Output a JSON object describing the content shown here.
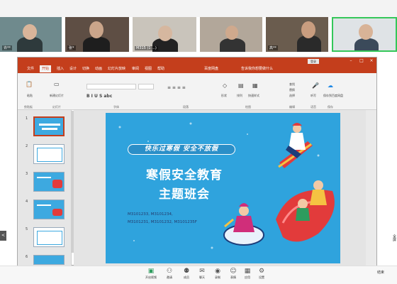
{
  "meeting": {
    "title": "",
    "top_right": "",
    "participants": [
      {
        "name": "许**",
        "bg": "#6f8a8d"
      },
      {
        "name": "张*",
        "bg": "#5e4e44"
      },
      {
        "name": "M315 (1 ...)",
        "bg": "#c9c4bb"
      },
      {
        "name": "",
        "bg": "#b2a79a"
      },
      {
        "name": "高**",
        "bg": "#6a5c4e"
      },
      {
        "name": "",
        "bg": "#dfe3e6"
      }
    ],
    "active_speaker_icon": "microphone-icon"
  },
  "ppt": {
    "app_title": "",
    "login_label": "登录",
    "window_controls": [
      "minimize-icon",
      "maximize-icon",
      "close-icon"
    ],
    "menu": [
      "文件",
      "开始",
      "插入",
      "设计",
      "切换",
      "动画",
      "幻灯片放映",
      "审阅",
      "视图",
      "帮助",
      "百度网盘",
      "告诉我你想要做什么"
    ],
    "active_menu": "开始",
    "ribbon_groups": [
      "剪贴板",
      "幻灯片",
      "字体",
      "段落",
      "绘图",
      "编辑",
      "语音",
      "保存"
    ],
    "ribbon_labels": {
      "paste": "粘贴",
      "new_slide": "新建幻灯片",
      "shapes": "形状",
      "arrange": "排列",
      "quick_styles": "快速样式",
      "find": "查找",
      "replace": "替换",
      "select": "选择",
      "dictate": "听写",
      "save": "保存到百度网盘"
    },
    "slides": [
      {
        "num": "1",
        "selected": true,
        "style": "blue"
      },
      {
        "num": "2",
        "selected": false,
        "style": "white"
      },
      {
        "num": "3",
        "selected": false,
        "style": "blue"
      },
      {
        "num": "4",
        "selected": false,
        "style": "blue"
      },
      {
        "num": "5",
        "selected": false,
        "style": "white"
      },
      {
        "num": "6",
        "selected": false,
        "style": "blue"
      }
    ],
    "slide_content": {
      "pill": "快乐过寒假  安全不放假",
      "title_line1": "寒假安全教育",
      "title_line2": "主题班会",
      "codes_line1": "M3101233, M3101234,",
      "codes_line2": "M3101231, M3101232, M3101235F"
    },
    "colors": {
      "accent": "#c43e1c",
      "slide_bg": "#2fa3dd"
    }
  },
  "toolbar": [
    {
      "label": "开启视频",
      "icon": "camera-icon"
    },
    {
      "label": "邀请",
      "icon": "invite-icon"
    },
    {
      "label": "成员",
      "icon": "members-icon"
    },
    {
      "label": "聊天",
      "icon": "chat-icon"
    },
    {
      "label": "录制",
      "icon": "record-icon"
    },
    {
      "label": "表情",
      "icon": "reaction-icon"
    },
    {
      "label": "应用",
      "icon": "apps-icon"
    },
    {
      "label": "设置",
      "icon": "settings-icon"
    }
  ],
  "side_labels": {
    "left": "<",
    "right_edge": "全屏",
    "bottom_left": "",
    "bottom_right": "结束"
  }
}
